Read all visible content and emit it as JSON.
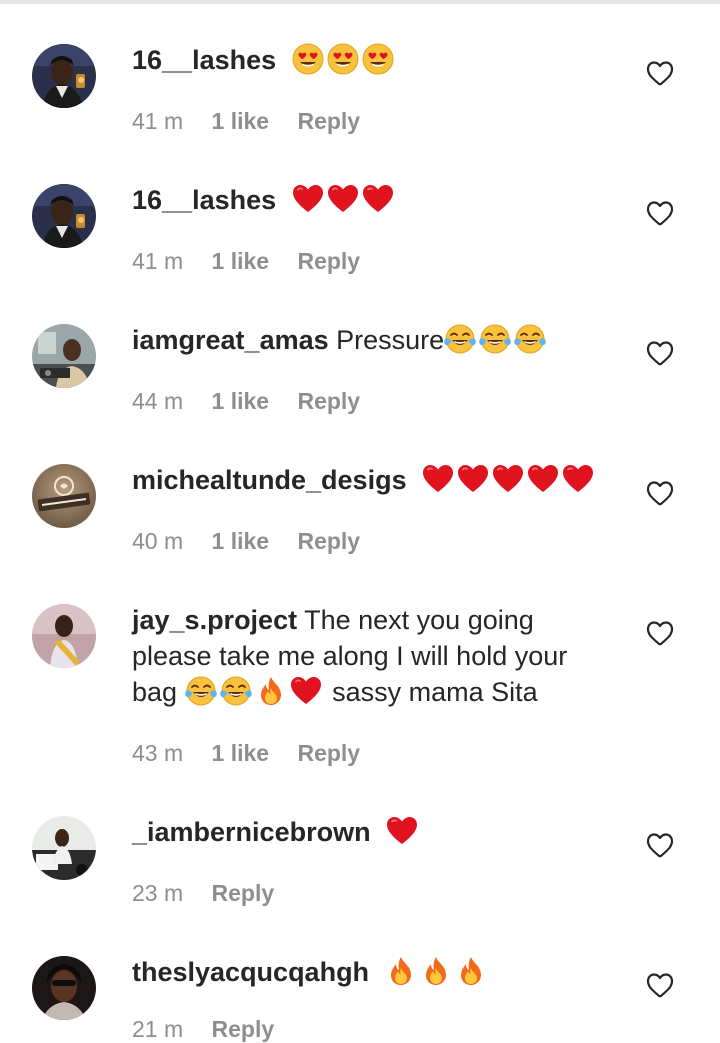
{
  "comments": [
    {
      "username": "16__lashes",
      "text": "",
      "emojis": [
        "heart-eyes",
        "heart-eyes",
        "heart-eyes"
      ],
      "time": "41 m",
      "likes": "1 like",
      "reply": "Reply",
      "avatar": "avatar-person-selfie"
    },
    {
      "username": "16__lashes",
      "text": "",
      "emojis": [
        "red-heart",
        "red-heart",
        "red-heart"
      ],
      "time": "41 m",
      "likes": "1 like",
      "reply": "Reply",
      "avatar": "avatar-person-selfie"
    },
    {
      "username": "iamgreat_amas",
      "text": "Pressure",
      "emojis": [
        "tears-of-joy",
        "tears-of-joy",
        "tears-of-joy"
      ],
      "time": "44 m",
      "likes": "1 like",
      "reply": "Reply",
      "avatar": "avatar-person-dj"
    },
    {
      "username": "michealtunde_desigs",
      "text": "",
      "emojis": [
        "red-heart",
        "red-heart",
        "red-heart",
        "red-heart",
        "red-heart"
      ],
      "time": "40 m",
      "likes": "1 like",
      "reply": "Reply",
      "avatar": "avatar-signage-logo"
    },
    {
      "username": "jay_s.project",
      "text_line1": "The next you going",
      "text_line2": "please take me along I will hold your",
      "text_line3_start": "bag",
      "text_line3_end": "sassy mama Sita",
      "emojis": [
        "tears-of-joy",
        "tears-of-joy",
        "fire",
        "red-heart"
      ],
      "time": "43 m",
      "likes": "1 like",
      "reply": "Reply",
      "avatar": "avatar-person-sash"
    },
    {
      "username": "_iambernicebrown",
      "text": "",
      "emojis": [
        "red-heart"
      ],
      "time": "23 m",
      "likes": "",
      "reply": "Reply",
      "avatar": "avatar-person-car"
    },
    {
      "username": "theslyacqucqahgh",
      "text": "",
      "emojis": [
        "fire",
        "fire",
        "fire"
      ],
      "time": "21 m",
      "likes": "",
      "reply": "Reply",
      "avatar": "avatar-person-sunglasses"
    }
  ],
  "colors": {
    "text": "#262626",
    "meta": "#8e8e8e",
    "heart_red": "#e0141e",
    "icon_outline": "#262626"
  }
}
